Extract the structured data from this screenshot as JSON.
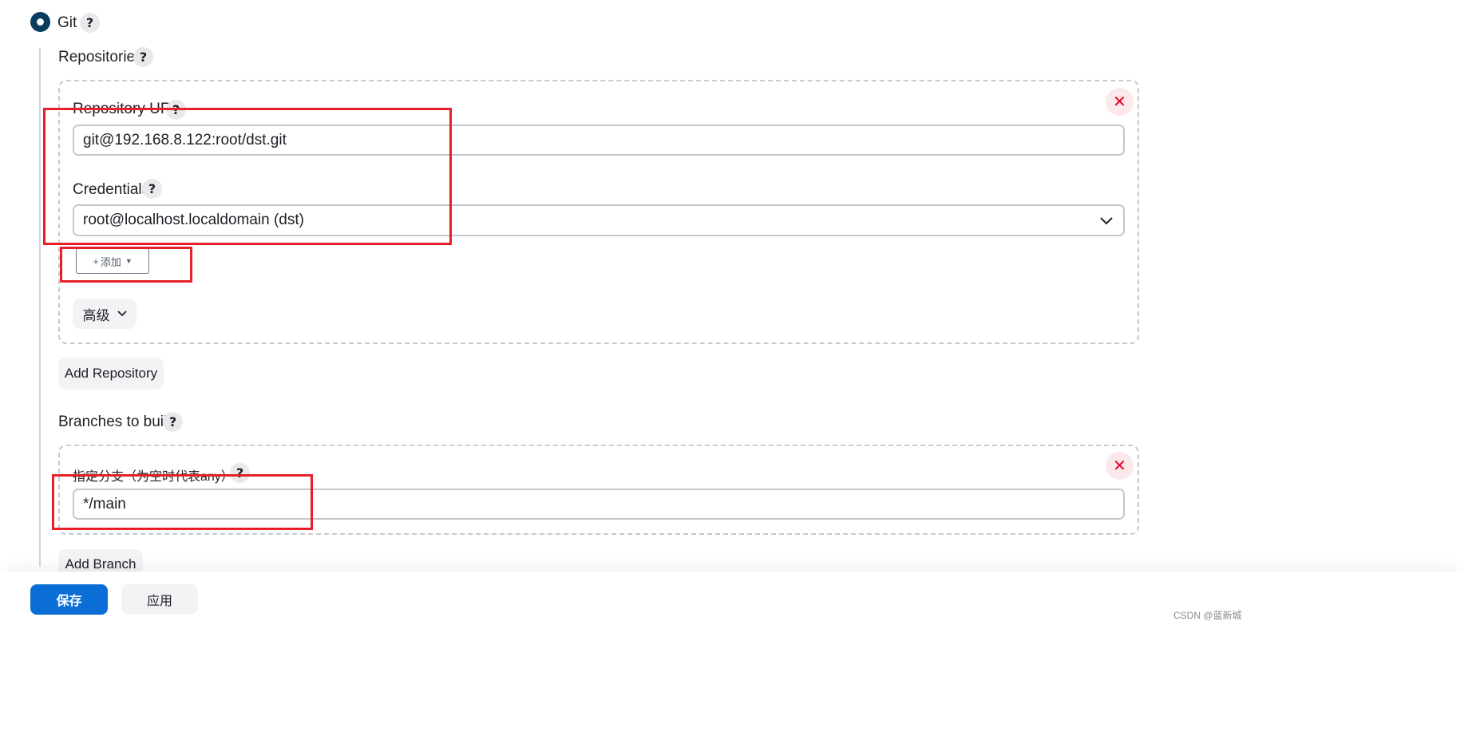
{
  "scm": {
    "git_label": "Git",
    "help": "?"
  },
  "repositories": {
    "title": "Repositories",
    "url_label": "Repository URL",
    "url_value": "git@192.168.8.122:root/dst.git",
    "credentials_label": "Credentials",
    "credentials_value": "root@localhost.localdomain (dst)",
    "add_label": "添加",
    "advanced_label": "高级",
    "add_repository_label": "Add Repository"
  },
  "branches": {
    "title": "Branches to build",
    "specifier_label": "指定分支（为空时代表any）",
    "specifier_value": "*/main",
    "add_branch_label": "Add Branch"
  },
  "footer": {
    "save_label": "保存",
    "apply_label": "应用"
  },
  "watermark": "CSDN @蓝新城",
  "colors": {
    "accent": "#0b6ed6",
    "radio": "#0b3c5d",
    "annotation_red": "#e8202a",
    "delete_red": "#e6001f"
  },
  "icons": [
    "radio-selected-icon",
    "help-icon",
    "close-icon",
    "chevron-down-icon",
    "caret-down-icon",
    "plus-icon"
  ]
}
